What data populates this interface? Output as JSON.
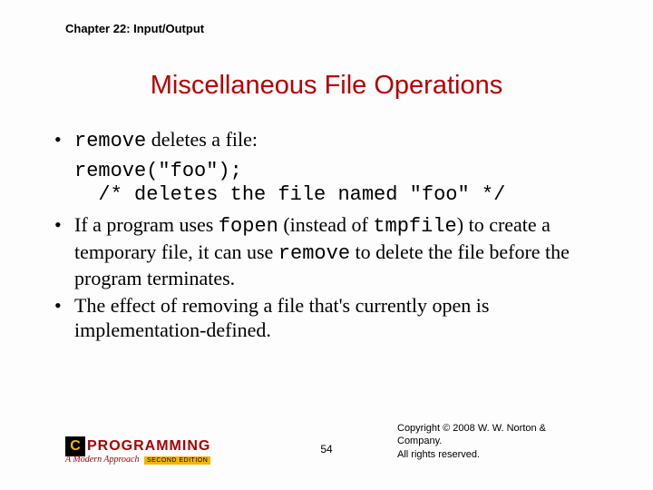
{
  "chapter": "Chapter 22: Input/Output",
  "title": "Miscellaneous File Operations",
  "bullets": {
    "b1_pre": "remove",
    "b1_post": " deletes a file:",
    "code_line1": "remove(\"foo\");",
    "code_line2": "  /* deletes the file named \"foo\" */",
    "b2_a": "If a program uses ",
    "b2_fopen": "fopen",
    "b2_b": " (instead of ",
    "b2_tmpfile": "tmpfile",
    "b2_c": ") to create a temporary file, it can use ",
    "b2_remove": "remove",
    "b2_d": " to delete the file before the program terminates.",
    "b3": "The effect of removing a file that's currently open is implementation-defined."
  },
  "footer": {
    "logo_c": "C",
    "logo_text": "PROGRAMMING",
    "logo_sub": "A Modern Approach",
    "logo_edition": "SECOND EDITION",
    "page": "54",
    "copyright_line1": "Copyright © 2008 W. W. Norton & Company.",
    "copyright_line2": "All rights reserved."
  }
}
